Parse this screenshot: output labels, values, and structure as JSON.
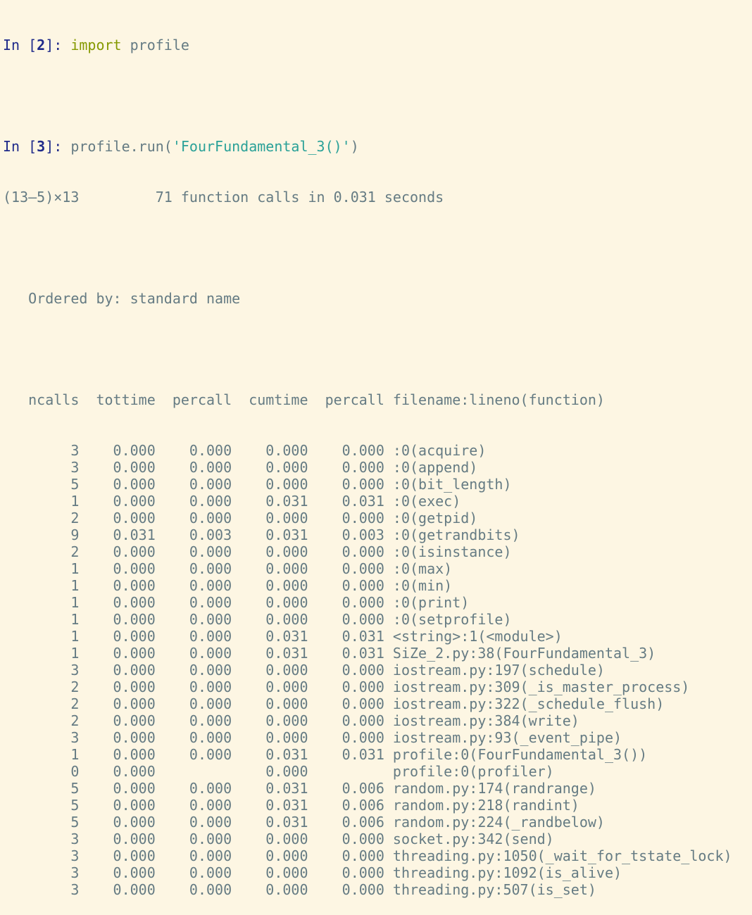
{
  "cells": [
    {
      "prompt_prefix": "In [",
      "prompt_num": "2",
      "prompt_suffix": "]: ",
      "keyword": "import",
      "rest": " profile"
    },
    {
      "prompt_prefix": "In [",
      "prompt_num": "3",
      "prompt_suffix": "]: ",
      "code_before": "profile.run(",
      "code_string": "'FourFundamental_3()'",
      "code_after": ")"
    }
  ],
  "output": {
    "header_left": "(13—5)×13",
    "header_right": "71 function calls in 0.031 seconds",
    "ordered_by": "Ordered by: standard name",
    "columns": [
      "ncalls",
      "tottime",
      "percall",
      "cumtime",
      "percall",
      "filename:lineno(function)"
    ],
    "rows": [
      [
        "3",
        "0.000",
        "0.000",
        "0.000",
        "0.000",
        ":0(acquire)"
      ],
      [
        "3",
        "0.000",
        "0.000",
        "0.000",
        "0.000",
        ":0(append)"
      ],
      [
        "5",
        "0.000",
        "0.000",
        "0.000",
        "0.000",
        ":0(bit_length)"
      ],
      [
        "1",
        "0.000",
        "0.000",
        "0.031",
        "0.031",
        ":0(exec)"
      ],
      [
        "2",
        "0.000",
        "0.000",
        "0.000",
        "0.000",
        ":0(getpid)"
      ],
      [
        "9",
        "0.031",
        "0.003",
        "0.031",
        "0.003",
        ":0(getrandbits)"
      ],
      [
        "2",
        "0.000",
        "0.000",
        "0.000",
        "0.000",
        ":0(isinstance)"
      ],
      [
        "1",
        "0.000",
        "0.000",
        "0.000",
        "0.000",
        ":0(max)"
      ],
      [
        "1",
        "0.000",
        "0.000",
        "0.000",
        "0.000",
        ":0(min)"
      ],
      [
        "1",
        "0.000",
        "0.000",
        "0.000",
        "0.000",
        ":0(print)"
      ],
      [
        "1",
        "0.000",
        "0.000",
        "0.000",
        "0.000",
        ":0(setprofile)"
      ],
      [
        "1",
        "0.000",
        "0.000",
        "0.031",
        "0.031",
        "<string>:1(<module>)"
      ],
      [
        "1",
        "0.000",
        "0.000",
        "0.031",
        "0.031",
        "SiZe_2.py:38(FourFundamental_3)"
      ],
      [
        "3",
        "0.000",
        "0.000",
        "0.000",
        "0.000",
        "iostream.py:197(schedule)"
      ],
      [
        "2",
        "0.000",
        "0.000",
        "0.000",
        "0.000",
        "iostream.py:309(_is_master_process)"
      ],
      [
        "2",
        "0.000",
        "0.000",
        "0.000",
        "0.000",
        "iostream.py:322(_schedule_flush)"
      ],
      [
        "2",
        "0.000",
        "0.000",
        "0.000",
        "0.000",
        "iostream.py:384(write)"
      ],
      [
        "3",
        "0.000",
        "0.000",
        "0.000",
        "0.000",
        "iostream.py:93(_event_pipe)"
      ],
      [
        "1",
        "0.000",
        "0.000",
        "0.031",
        "0.031",
        "profile:0(FourFundamental_3())"
      ],
      [
        "0",
        "0.000",
        "",
        "0.000",
        "",
        "profile:0(profiler)"
      ],
      [
        "5",
        "0.000",
        "0.000",
        "0.031",
        "0.006",
        "random.py:174(randrange)"
      ],
      [
        "5",
        "0.000",
        "0.000",
        "0.031",
        "0.006",
        "random.py:218(randint)"
      ],
      [
        "5",
        "0.000",
        "0.000",
        "0.031",
        "0.006",
        "random.py:224(_randbelow)"
      ],
      [
        "3",
        "0.000",
        "0.000",
        "0.000",
        "0.000",
        "socket.py:342(send)"
      ],
      [
        "3",
        "0.000",
        "0.000",
        "0.000",
        "0.000",
        "threading.py:1050(_wait_for_tstate_lock)"
      ],
      [
        "3",
        "0.000",
        "0.000",
        "0.000",
        "0.000",
        "threading.py:1092(is_alive)"
      ],
      [
        "3",
        "0.000",
        "0.000",
        "0.000",
        "0.000",
        "threading.py:507(is_set)"
      ]
    ]
  },
  "colors": {
    "background": "#fdf6e3",
    "text": "#657b83",
    "prompt": "#1f2a8a",
    "keyword": "#859900",
    "string": "#2aa198"
  }
}
